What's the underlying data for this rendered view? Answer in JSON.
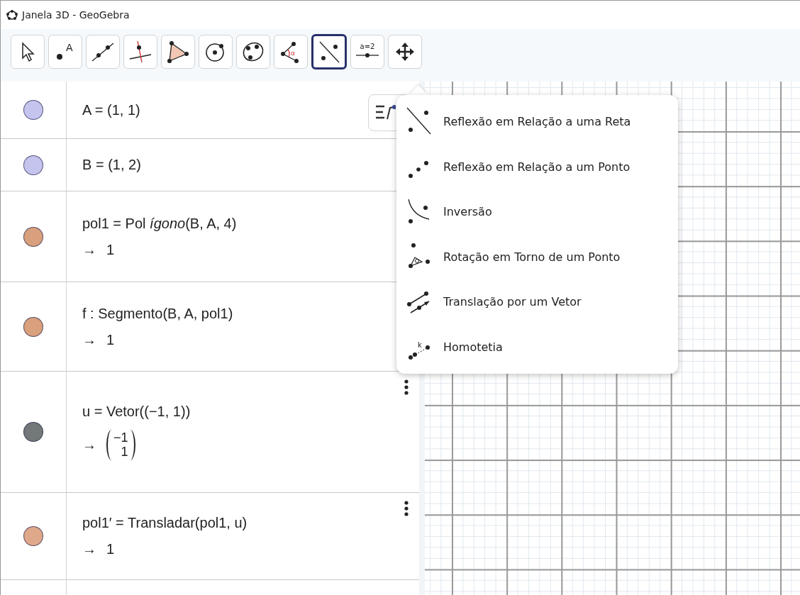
{
  "window": {
    "title": "Janela 3D - GeoGebra"
  },
  "toolbar": {
    "tools": [
      {
        "kind": "move",
        "selected": false
      },
      {
        "kind": "point",
        "label": "A",
        "selected": false
      },
      {
        "kind": "line",
        "selected": false
      },
      {
        "kind": "perpendicular",
        "selected": false
      },
      {
        "kind": "polygon",
        "selected": false
      },
      {
        "kind": "circle",
        "selected": false
      },
      {
        "kind": "conic",
        "selected": false
      },
      {
        "kind": "angle",
        "label": "α",
        "selected": false
      },
      {
        "kind": "reflect",
        "selected": true
      },
      {
        "kind": "slider",
        "label": "a=2",
        "selected": false
      },
      {
        "kind": "pan",
        "selected": false
      }
    ]
  },
  "algebra": {
    "rows": [
      {
        "color": "#c4c4ef",
        "definition": "A = (1, 1)"
      },
      {
        "color": "#c4c4ef",
        "definition": "B = (1, 2)"
      },
      {
        "color": "#d9a07e",
        "definition": "pol1 = Pol *ígono*(B, A, 4)",
        "output": {
          "kind": "value",
          "arrow": "→",
          "value": "1"
        }
      },
      {
        "color": "#d9a07e",
        "definition": "f : Segmento(B, A, pol1)",
        "output": {
          "kind": "value",
          "arrow": "→",
          "value": "1"
        }
      },
      {
        "color": "#737878",
        "definition": "u = Vetor((−1, 1))",
        "output": {
          "kind": "vector",
          "arrow": "→",
          "values": [
            "−1",
            "1"
          ]
        },
        "menu": true
      },
      {
        "color": "#e0a88a",
        "definition": "pol1′ = Transladar(pol1, u)",
        "output": {
          "kind": "value",
          "arrow": "→",
          "value": "1"
        },
        "menu": true
      },
      {
        "color": null,
        "definition": null
      }
    ]
  },
  "tool_menu": {
    "items": [
      {
        "kind": "reflect-line",
        "label": "Reflexão em Relação a uma Reta"
      },
      {
        "kind": "reflect-point",
        "label": "Reflexão em Relação a um Ponto"
      },
      {
        "kind": "inversion",
        "label": "Inversão"
      },
      {
        "kind": "rotate",
        "label": "Rotação em Torno de um Ponto"
      },
      {
        "kind": "translate",
        "label": "Translação por um Vetor"
      },
      {
        "kind": "dilate",
        "label": "Homotetia",
        "icon_label": "k"
      }
    ]
  }
}
